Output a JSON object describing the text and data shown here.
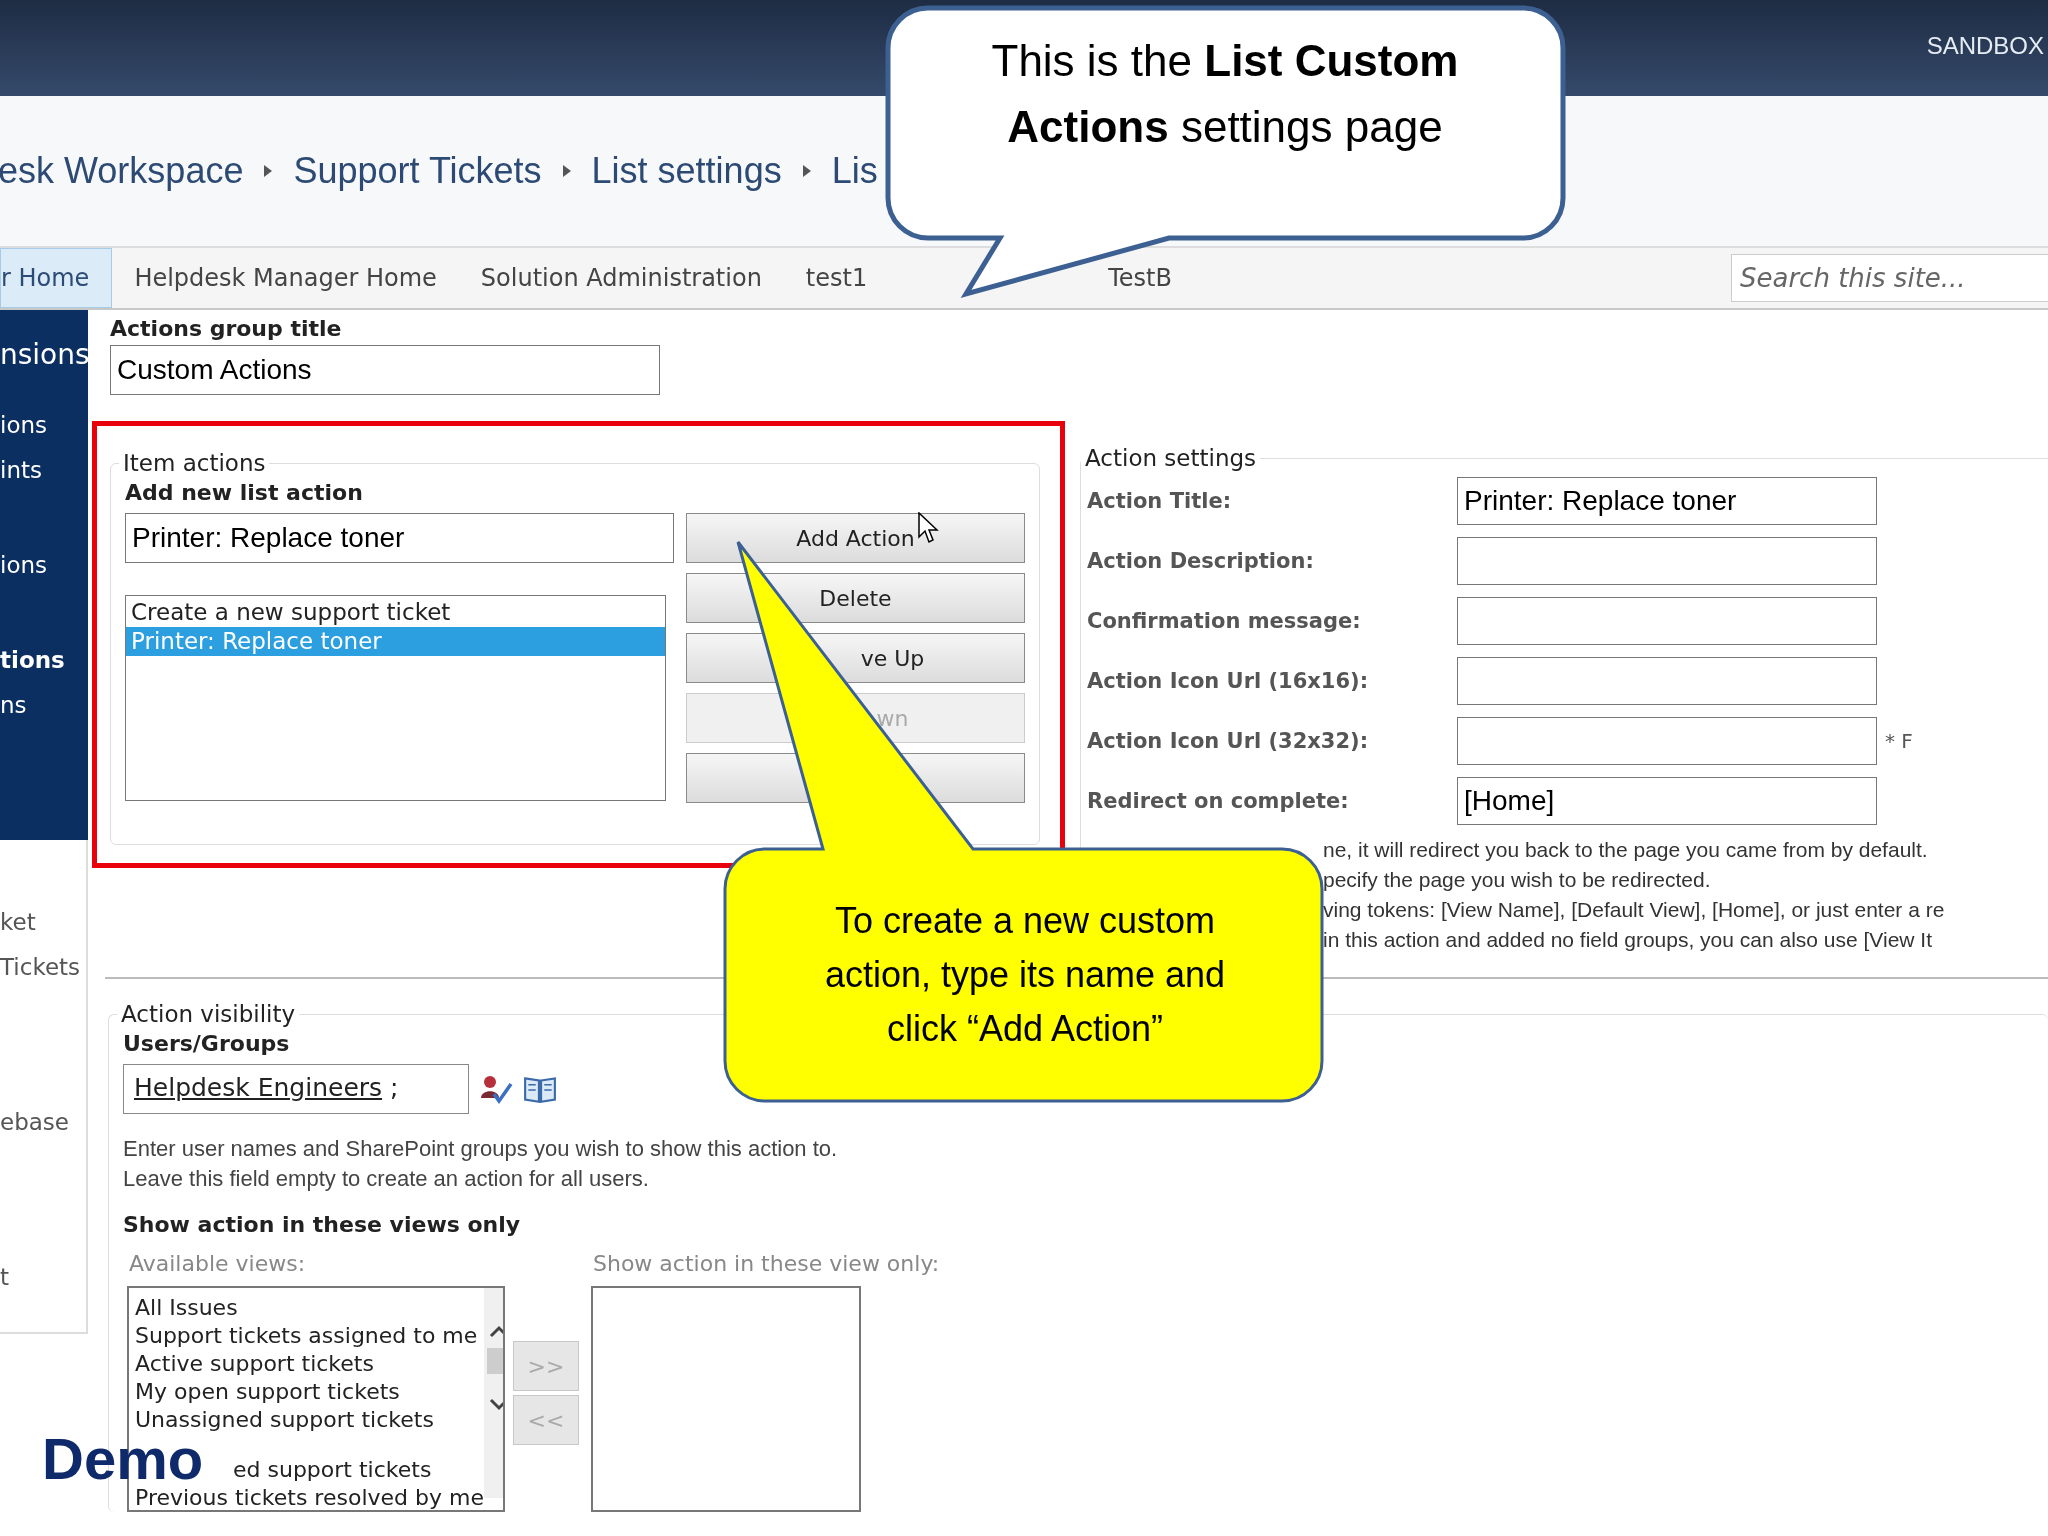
{
  "top_bar": {
    "site_label": "SANDBOX"
  },
  "breadcrumb": [
    "esk Workspace",
    "Support Tickets",
    "List settings",
    "Lis"
  ],
  "nav": {
    "tabs": [
      {
        "label": "r Home",
        "selected": true
      },
      {
        "label": "Helpdesk Manager Home",
        "selected": false
      },
      {
        "label": "Solution Administration",
        "selected": false
      },
      {
        "label": "test1",
        "selected": false
      },
      {
        "label": "TestB",
        "selected": false
      }
    ],
    "search": {
      "placeholder": "Search this site..."
    }
  },
  "sidebar": {
    "sections": [
      {
        "kind": "dark",
        "groups": [
          {
            "items": [
              {
                "label": "nsions",
                "kind": "heading",
                "selected": false
              }
            ]
          },
          {
            "items": [
              {
                "label": "ions",
                "kind": "link",
                "selected": false
              },
              {
                "label": "ints",
                "kind": "link",
                "selected": false
              }
            ]
          },
          {
            "items": [
              {
                "label": "ions",
                "kind": "link",
                "selected": false
              }
            ]
          },
          {
            "items": [
              {
                "label": "tions",
                "kind": "link",
                "selected": true
              },
              {
                "label": "ns",
                "kind": "link",
                "selected": false
              }
            ]
          }
        ]
      },
      {
        "kind": "light",
        "groups": [
          {
            "items": [
              {
                "label": "ket",
                "kind": "link",
                "selected": false
              },
              {
                "label": "Tickets",
                "kind": "link",
                "selected": false
              }
            ]
          },
          {
            "items": [
              {
                "label": "ebase",
                "kind": "link",
                "selected": false
              }
            ]
          },
          {
            "items": [
              {
                "label": "t",
                "kind": "link",
                "selected": false
              }
            ]
          }
        ]
      }
    ]
  },
  "actions_group": {
    "label": "Actions group title",
    "value": "Custom Actions"
  },
  "item_actions": {
    "legend": "Item actions",
    "add_label": "Add new list action",
    "name_value": "Printer: Replace toner",
    "actions": [
      {
        "label": "Create a new support ticket",
        "selected": false
      },
      {
        "label": "Printer: Replace toner",
        "selected": true
      }
    ],
    "buttons": [
      {
        "label": "Add Action",
        "disabled": false
      },
      {
        "label": "Delete",
        "disabled": false
      },
      {
        "label": "ve Up",
        "disabled": false
      },
      {
        "label": "wn",
        "disabled": true
      },
      {
        "disabled": false
      }
    ]
  },
  "action_settings": {
    "legend": "Action settings",
    "fields": [
      {
        "label": "Action Title:",
        "value": "Printer: Replace toner"
      },
      {
        "label": "Action Description:"
      },
      {
        "label": "Confirmation message:"
      },
      {
        "label": "Action Icon Url (16x16):"
      },
      {
        "label": "Action Icon Url (32x32):",
        "note": "* F"
      },
      {
        "label": "Redirect on complete:",
        "value": "[Home]"
      }
    ],
    "help": [
      "ne, it will redirect you back to the page you came from by default.",
      "pecify the page you wish to be redirected.",
      "ving tokens: [View Name], [Default View], [Home], or just enter a re",
      "in this action and added no field groups, you can also use [View It"
    ]
  },
  "visibility": {
    "legend": "Action visibility",
    "users_label": "Users/Groups",
    "users_value": {
      "name": "Helpdesk Engineers",
      "suffix": ";"
    },
    "help": [
      "Enter user names and SharePoint groups you wish to show this action to.",
      "Leave this field empty to create an action for all users."
    ],
    "views_label": "Show action in these views only",
    "available_label": "Available views:",
    "available": [
      {
        "label": "All Issues",
        "kind": "whole"
      },
      {
        "label": "Support tickets assigned to me",
        "kind": "whole"
      },
      {
        "label": "Active support tickets",
        "kind": "whole"
      },
      {
        "label": "My open support tickets",
        "kind": "whole"
      },
      {
        "label": "Unassigned support tickets",
        "kind": "whole"
      },
      {
        "label": "ed support tickets",
        "kind": "partial"
      },
      {
        "label": "Previous tickets resolved by me",
        "kind": "whole"
      }
    ],
    "move_buttons": [
      {
        "label": ">>",
        "disabled": true
      },
      {
        "label": "<<",
        "disabled": true
      }
    ],
    "selected_label": "Show action in these view only:"
  },
  "callouts": [
    {
      "kind": "note",
      "text": "This is the **List Custom Actions** settings page"
    },
    {
      "kind": "tip",
      "text": "To create a new custom action, type its name and click “Add Action”"
    }
  ],
  "slide_label": "Demo"
}
